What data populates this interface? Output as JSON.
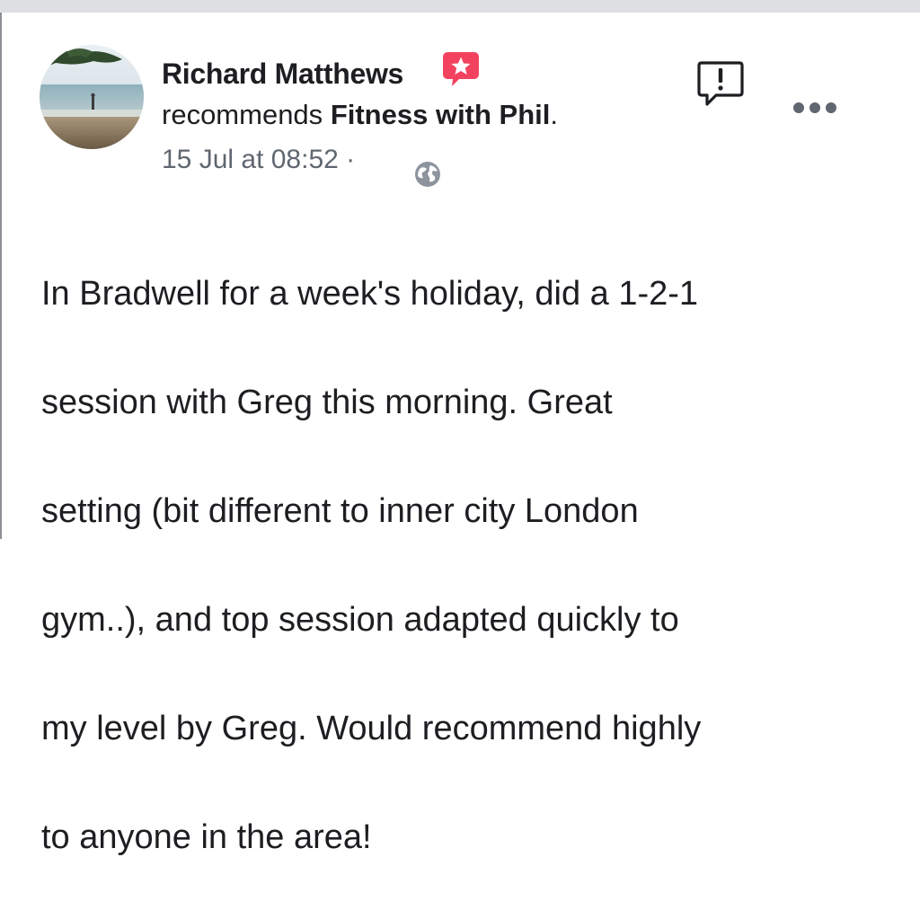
{
  "post": {
    "author": {
      "name": "Richard Matthews",
      "badge_icon": "recommendation-star-icon"
    },
    "action": {
      "verb": "recommends",
      "page": "Fitness with Phil",
      "end": "."
    },
    "meta": {
      "timestamp": "15 Jul at 08:52",
      "separator": "·",
      "privacy_icon": "globe-icon"
    },
    "controls": {
      "report_icon": "report-flag-icon",
      "more_icon": "more-options-icon"
    },
    "body_lines": [
      "In Bradwell for a week's holiday, did a 1-2-1",
      "session with Greg this morning. Great",
      "setting (bit different to inner city London",
      "gym..), and top session adapted quickly to",
      "my level by Greg. Would recommend highly",
      "to anyone in the area!"
    ]
  },
  "colors": {
    "background": "#ffffff",
    "top_strip": "#dddfe2",
    "text_primary": "#1c1e21",
    "text_secondary": "#606770",
    "badge_red": "#f3425f",
    "icon_gray": "#8d949e"
  }
}
